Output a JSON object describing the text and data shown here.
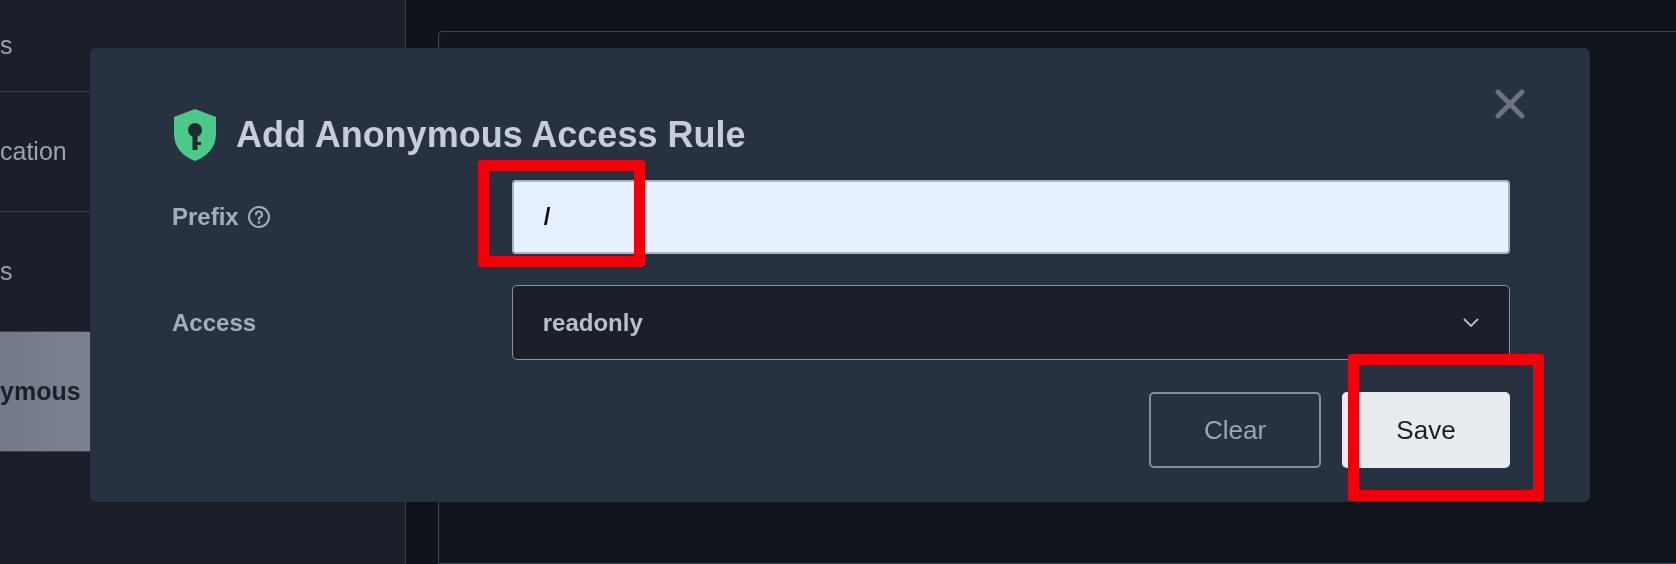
{
  "sidebar": {
    "items": [
      {
        "label": "s",
        "selected": false
      },
      {
        "label": "cation",
        "selected": false
      },
      {
        "label": "s",
        "selected": false
      },
      {
        "label": "ymous",
        "selected": true
      }
    ]
  },
  "dialog": {
    "title": "Add Anonymous Access Rule",
    "fields": [
      {
        "kind": "text",
        "label": "Prefix",
        "help": true,
        "value": "/"
      },
      {
        "kind": "select",
        "label": "Access",
        "help": false,
        "value": "readonly"
      }
    ],
    "buttons": [
      {
        "kind": "secondary",
        "label": "Clear"
      },
      {
        "kind": "primary",
        "label": "Save"
      }
    ]
  }
}
